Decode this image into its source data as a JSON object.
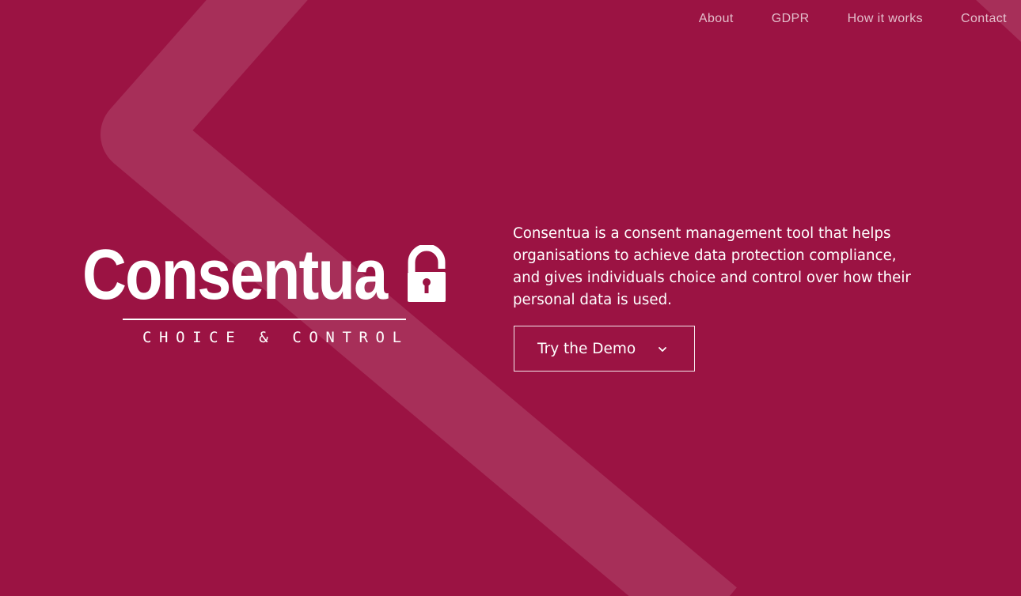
{
  "nav": {
    "items": [
      {
        "label": "About"
      },
      {
        "label": "GDPR"
      },
      {
        "label": "How it works"
      },
      {
        "label": "Contact"
      }
    ]
  },
  "logo": {
    "wordmark": "Consentua",
    "tagline": "CHOICE & CONTROL",
    "icon": "padlock-icon"
  },
  "hero": {
    "intro": "Consentua is a consent management tool that helps organisations to achieve data protection compliance, and gives individuals choice and control over how their personal data is used.",
    "cta_label": "Try the Demo",
    "cta_icon": "chevron-down-icon"
  },
  "colors": {
    "background": "#9b1343",
    "text": "#ffffff",
    "chevron_overlay": "rgba(255,255,255,0.12)"
  }
}
